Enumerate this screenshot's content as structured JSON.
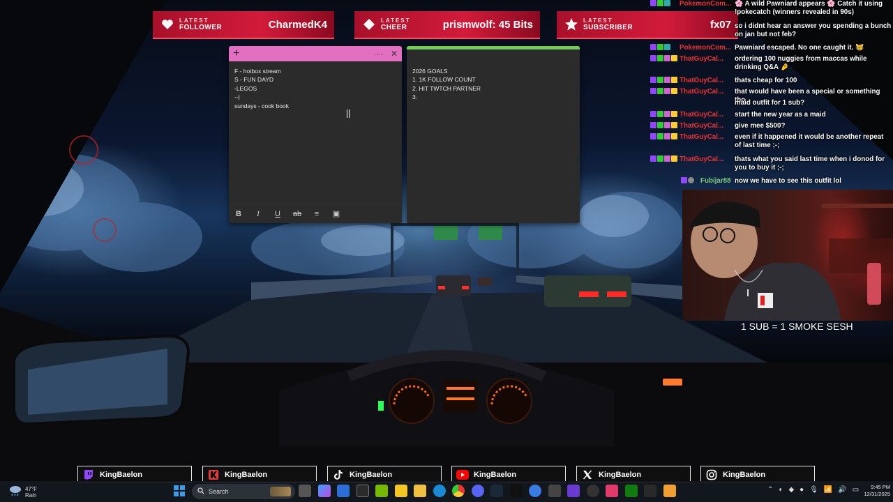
{
  "banners": [
    {
      "small": "LATEST",
      "type": "FOLLOWER",
      "name": "CharmedK4",
      "icon": "heart-icon"
    },
    {
      "small": "LATEST",
      "type": "CHEER",
      "name": "prismwolf: 45 Bits",
      "icon": "diamond-icon"
    },
    {
      "small": "LATEST",
      "type": "SUBSCRIBER",
      "name": "fx07",
      "icon": "star-icon"
    }
  ],
  "note1": {
    "lines": [
      "F -  hotbox stream",
      "S - FUN DAYD",
      "-LEGOS",
      "--|",
      "sundays - cook book"
    ],
    "toolbar": [
      "B",
      "I",
      "U",
      "ab",
      "≡",
      "▣"
    ]
  },
  "note2": {
    "lines": [
      "2026 GOALS",
      "1. 1K FOLLOW COUNT",
      "2. HIT TWTCH PARTNER",
      "3."
    ]
  },
  "chat": [
    {
      "user": "PokemonCom...",
      "color": "#e33",
      "text": "🌸 A wild Pawniard appears 🌸 Catch it using !pokecatch (winners revealed in 90s)"
    },
    {
      "user": "",
      "color": "#e33",
      "text": "so i didnt hear an answer you spending a bunch on jan but not feb?"
    },
    {
      "user": "PokemonCom...",
      "color": "#e33",
      "text": "Pawniard escaped. No one caught it. 😿"
    },
    {
      "user": "ThatGuyCal...",
      "color": "#e33",
      "text": "ordering 100 nuggies from maccas while drinking Q&A 🤌"
    },
    {
      "user": "ThatGuyCal...",
      "color": "#e33",
      "text": "thats cheap for 100"
    },
    {
      "user": "ThatGuyCal...",
      "color": "#e33",
      "text": "that would have been a special or something tho"
    },
    {
      "user": "",
      "color": "#e33",
      "text": "maid outfit for 1 sub?"
    },
    {
      "user": "ThatGuyCal...",
      "color": "#e33",
      "text": "start the new year as a maid"
    },
    {
      "user": "ThatGuyCal...",
      "color": "#e33",
      "text": "give mee $500?"
    },
    {
      "user": "ThatGuyCal...",
      "color": "#e33",
      "text": "even if it happened it would be another repeat of last time ;-;"
    },
    {
      "user": "ThatGuyCal...",
      "color": "#e33",
      "text": "thats what you said last time when i donod for you to buy it ;-;"
    },
    {
      "user": "Fubijar88",
      "color": "#7fc97f",
      "text": "now we have to see this outfit lol"
    }
  ],
  "cam_caption": "1 SUB = 1 SMOKE SESH",
  "socials": [
    {
      "name": "KingBaelon",
      "icon": "twitch-icon",
      "color": "#9146ff"
    },
    {
      "name": "KingBaelon",
      "icon": "kick-icon",
      "color": "#e63b3b"
    },
    {
      "name": "KingBaelon",
      "icon": "tiktok-icon",
      "color": "#ffffff"
    },
    {
      "name": "KingBaelon",
      "icon": "youtube-icon",
      "color": "#ff0000"
    },
    {
      "name": "KingBaelon",
      "icon": "x-icon",
      "color": "#ffffff"
    },
    {
      "name": "KingBaelon",
      "icon": "instagram-icon",
      "color": "#ffffff"
    }
  ],
  "taskbar": {
    "weather_temp": "47°F",
    "weather_desc": "Rain",
    "search_placeholder": "Search",
    "time": "9:45 PM",
    "date": "12/31/2025"
  }
}
